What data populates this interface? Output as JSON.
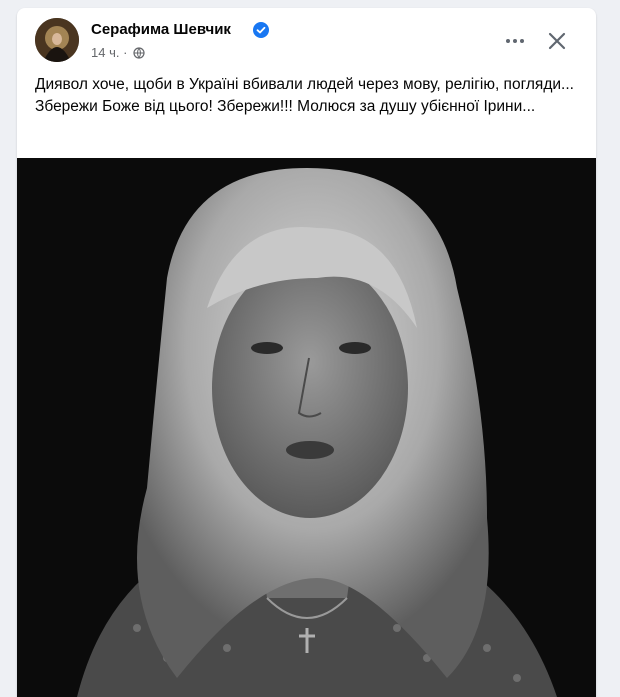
{
  "post": {
    "author": "Серафима Шевчик",
    "time": "14 ч.",
    "separator": "·",
    "text": "Диявол хоче, щоби в Україні вбивали людей через мову, релігію, погляди... Збережи Боже від цього! Збережи!!! Молюся за душу убієнної Ірини..."
  },
  "icons": {
    "verified": "verified-badge-icon",
    "privacy": "globe-icon",
    "more": "more-options-icon",
    "close": "close-icon"
  },
  "colors": {
    "background": "#eef0f4",
    "card": "#ffffff",
    "verified": "#1877f2",
    "meta_text": "#65676b",
    "photo_background": "#0b0b0b"
  }
}
